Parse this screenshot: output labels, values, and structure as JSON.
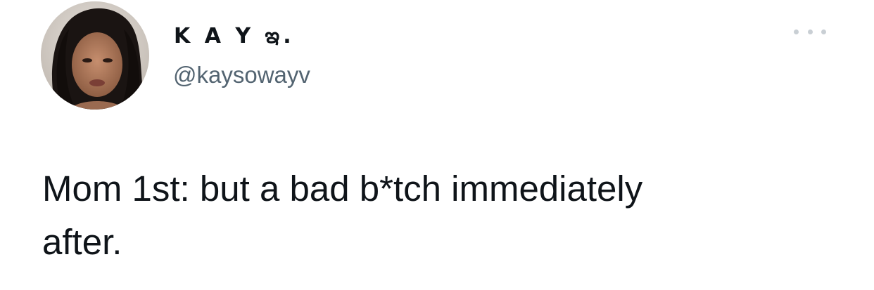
{
  "tweet": {
    "author": {
      "display_name": "K A Y ఇ.",
      "handle": "@kaysowayv",
      "avatar_icon": "profile-photo"
    },
    "more_options_icon": "more-horizontal-icon",
    "text_line1": "Mom 1st: but a bad b*tch immediately",
    "text_line2": "after."
  }
}
